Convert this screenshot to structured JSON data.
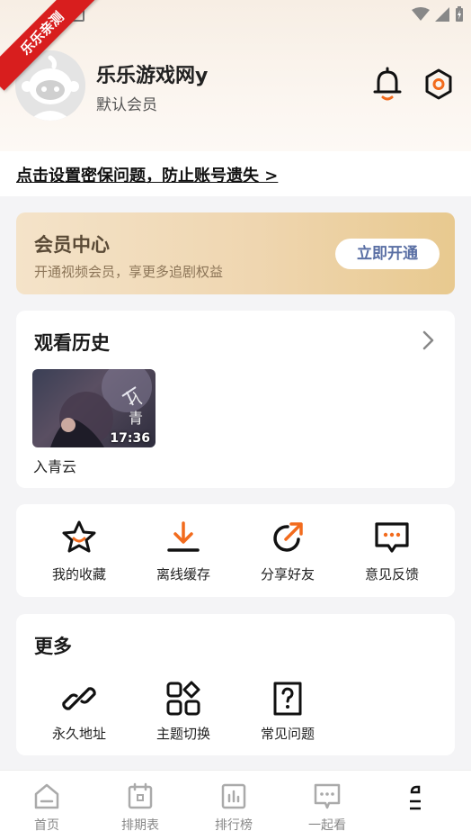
{
  "watermark": {
    "text": "乐乐亲测"
  },
  "status_bar": {
    "icons": [
      "wifi-icon",
      "signal-icon",
      "battery-charging-icon"
    ]
  },
  "profile": {
    "username": "乐乐游戏网y",
    "member_level": "默认会员"
  },
  "header_icons": [
    "bell-icon",
    "settings-hex-icon"
  ],
  "security_prompt": "点击设置密保问题，防止账号遗失 >",
  "vip": {
    "title": "会员中心",
    "subtitle": "开通视频会员，享更多追剧权益",
    "button": "立即开通"
  },
  "history": {
    "title": "观看历史",
    "items": [
      {
        "title": "入青云",
        "time": "17:36",
        "poster_text": "入青"
      }
    ]
  },
  "actions": [
    {
      "label": "我的收藏",
      "icon": "star-icon"
    },
    {
      "label": "离线缓存",
      "icon": "download-icon"
    },
    {
      "label": "分享好友",
      "icon": "share-icon"
    },
    {
      "label": "意见反馈",
      "icon": "feedback-icon"
    }
  ],
  "more": {
    "title": "更多",
    "items": [
      {
        "label": "永久地址",
        "icon": "link-icon"
      },
      {
        "label": "主题切换",
        "icon": "theme-icon"
      },
      {
        "label": "常见问题",
        "icon": "faq-icon"
      }
    ]
  },
  "bottom_nav": [
    {
      "label": "首页",
      "icon": "home-icon"
    },
    {
      "label": "排期表",
      "icon": "calendar-icon"
    },
    {
      "label": "排行榜",
      "icon": "chart-icon"
    },
    {
      "label": "一起看",
      "icon": "chat-icon"
    },
    {
      "label": "",
      "icon": "profile-icon"
    }
  ],
  "colors": {
    "accent": "#f26b1d",
    "vip_gradient_start": "#f4e3c9",
    "vip_gradient_end": "#e8c98f",
    "vip_button_text": "#5a6fa4",
    "ribbon": "#d81e1e"
  }
}
